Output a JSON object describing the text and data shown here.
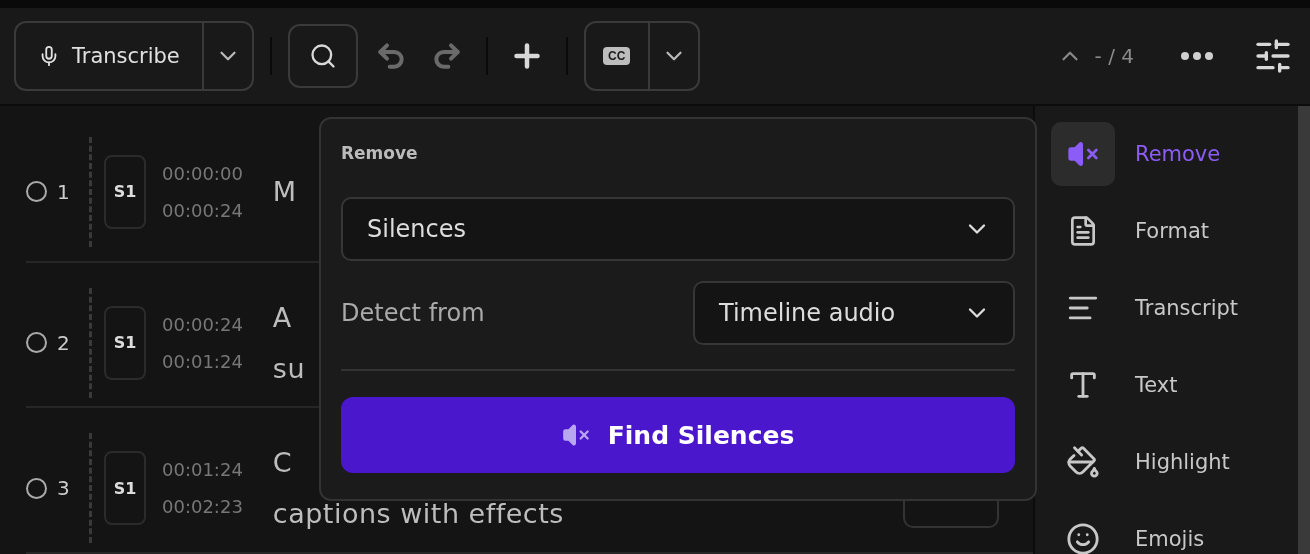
{
  "toolbar": {
    "transcribe_button": "Transcribe",
    "undo": {
      "disabled": true
    },
    "redo": {
      "disabled": true
    },
    "add": {
      "disabled": false
    },
    "caption_badge": "CC",
    "counter": "- / 4"
  },
  "rows": [
    {
      "number": "1",
      "selected": false,
      "speaker": "S1",
      "start": "00:00:00",
      "end": "00:00:24",
      "lines": [
        "M"
      ]
    },
    {
      "number": "2",
      "selected": false,
      "speaker": "S1",
      "start": "00:00:24",
      "end": "00:01:24",
      "lines": [
        "A",
        "su"
      ]
    },
    {
      "number": "3",
      "selected": false,
      "speaker": "S1",
      "start": "00:01:24",
      "end": "00:02:23",
      "lines": [
        "C",
        "captions with effects"
      ]
    }
  ],
  "popover": {
    "title": "Remove",
    "type_select": "Silences",
    "detect_label": "Detect from",
    "source_select": "Timeline audio",
    "action": "Find Silences"
  },
  "sidebar": {
    "items": [
      {
        "kind": "remove",
        "label": "Remove",
        "selected": true
      },
      {
        "kind": "format",
        "label": "Format",
        "selected": false
      },
      {
        "kind": "transcript",
        "label": "Transcript",
        "selected": false
      },
      {
        "kind": "text",
        "label": "Text",
        "selected": false
      },
      {
        "kind": "highlight",
        "label": "Highlight",
        "selected": false
      },
      {
        "kind": "emojis",
        "label": "Emojis",
        "selected": false
      }
    ]
  }
}
